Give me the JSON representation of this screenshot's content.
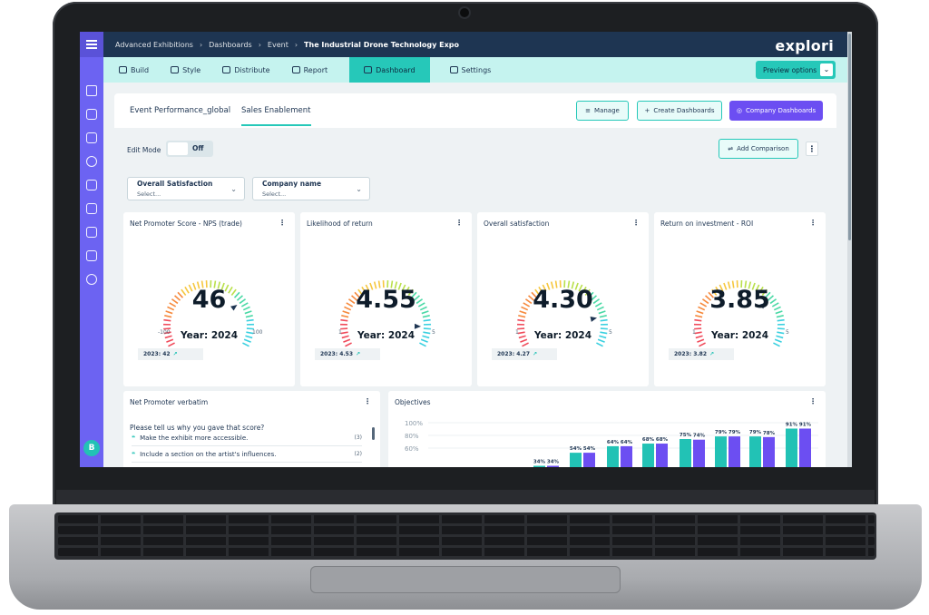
{
  "breadcrumb": [
    "Advanced Exhibitions",
    "Dashboards",
    "Event",
    "The Industrial Drone Technology Expo"
  ],
  "logo": "explori",
  "toolbar": {
    "items": [
      "Build",
      "Style",
      "Distribute",
      "Report",
      "Dashboard",
      "Settings"
    ],
    "active": "Dashboard",
    "preview_label": "Preview options"
  },
  "tabs": [
    "Event Performance_global",
    "Sales Enablement"
  ],
  "active_tab": "Sales Enablement",
  "buttons": {
    "manage": "Manage",
    "create": "Create Dashboards",
    "company": "Company Dashboards",
    "add_comparison": "Add Comparison"
  },
  "edit_mode": {
    "label": "Edit Mode",
    "state": "Off"
  },
  "filters": [
    {
      "label": "Overall Satisfaction",
      "value": "Select..."
    },
    {
      "label": "Company name",
      "value": "Select..."
    }
  ],
  "kpis": [
    {
      "title": "Net Promoter Score - NPS (trade)",
      "value": "46",
      "year": "Year: 2024",
      "min": "-100",
      "max": "100",
      "prev": "2023: 42",
      "level": 0.73
    },
    {
      "title": "Likelihood of return",
      "value": "4.55",
      "year": "Year: 2024",
      "min": "1",
      "max": "5",
      "prev": "2023: 4.53",
      "level": 0.89
    },
    {
      "title": "Overall satisfaction",
      "value": "4.30",
      "year": "Year: 2024",
      "min": "1",
      "max": "5",
      "prev": "2023: 4.27",
      "level": 0.83
    },
    {
      "title": "Return on investment - ROI",
      "value": "3.85",
      "year": "Year: 2024",
      "min": "1",
      "max": "5",
      "prev": "2023: 3.82",
      "level": 0.71
    }
  ],
  "verbatim": {
    "title": "Net Promoter verbatim",
    "question": "Please tell us why you gave that score?",
    "items": [
      {
        "text": "Make the exhibit more accessible.",
        "count": "(3)"
      },
      {
        "text": "Include a section on the artist's influences.",
        "count": "(2)"
      }
    ]
  },
  "objectives": {
    "title": "Objectives"
  },
  "chart_data": {
    "type": "bar",
    "yticks": [
      "100%",
      "80%",
      "60%"
    ],
    "ylim": [
      0,
      100
    ],
    "series": [
      {
        "values": [
          34,
          54,
          64,
          68,
          75,
          79,
          79,
          91
        ]
      },
      {
        "values": [
          34,
          54,
          64,
          68,
          74,
          79,
          78,
          91
        ]
      }
    ],
    "labels": [
      [
        "34%",
        "34%"
      ],
      [
        "54%",
        "54%"
      ],
      [
        "64%",
        "64%"
      ],
      [
        "68%",
        "68%"
      ],
      [
        "75%",
        "74%"
      ],
      [
        "79%",
        "79%"
      ],
      [
        "79%",
        "78%"
      ],
      [
        "91%",
        "91%"
      ]
    ],
    "colors": [
      "#22c2b5",
      "#6c4ef2"
    ]
  }
}
